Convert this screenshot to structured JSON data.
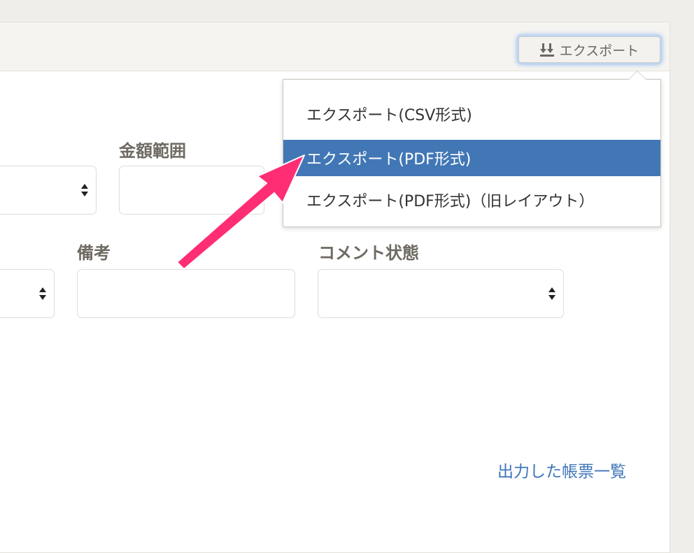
{
  "toolbar": {
    "export_label": "エクスポート",
    "export_icon": "export-download-icon"
  },
  "form": {
    "amount_range_label": "金額範囲",
    "memo_label": "備考",
    "comment_status_label": "コメント状態",
    "amount_range_value": "",
    "memo_value": "",
    "comment_status_value": ""
  },
  "export_menu": {
    "items": [
      {
        "label": "エクスポート(CSV形式)"
      },
      {
        "label": "エクスポート(PDF形式)",
        "highlighted": true
      },
      {
        "label": "エクスポート(PDF形式)（旧レイアウト）"
      }
    ]
  },
  "output_list_link": "出力した帳票一覧",
  "colors": {
    "accent": "#4277b6",
    "link": "#3f76b8",
    "annotation_arrow": "#ff2e74",
    "focus_glow": "#8fb8ec"
  }
}
